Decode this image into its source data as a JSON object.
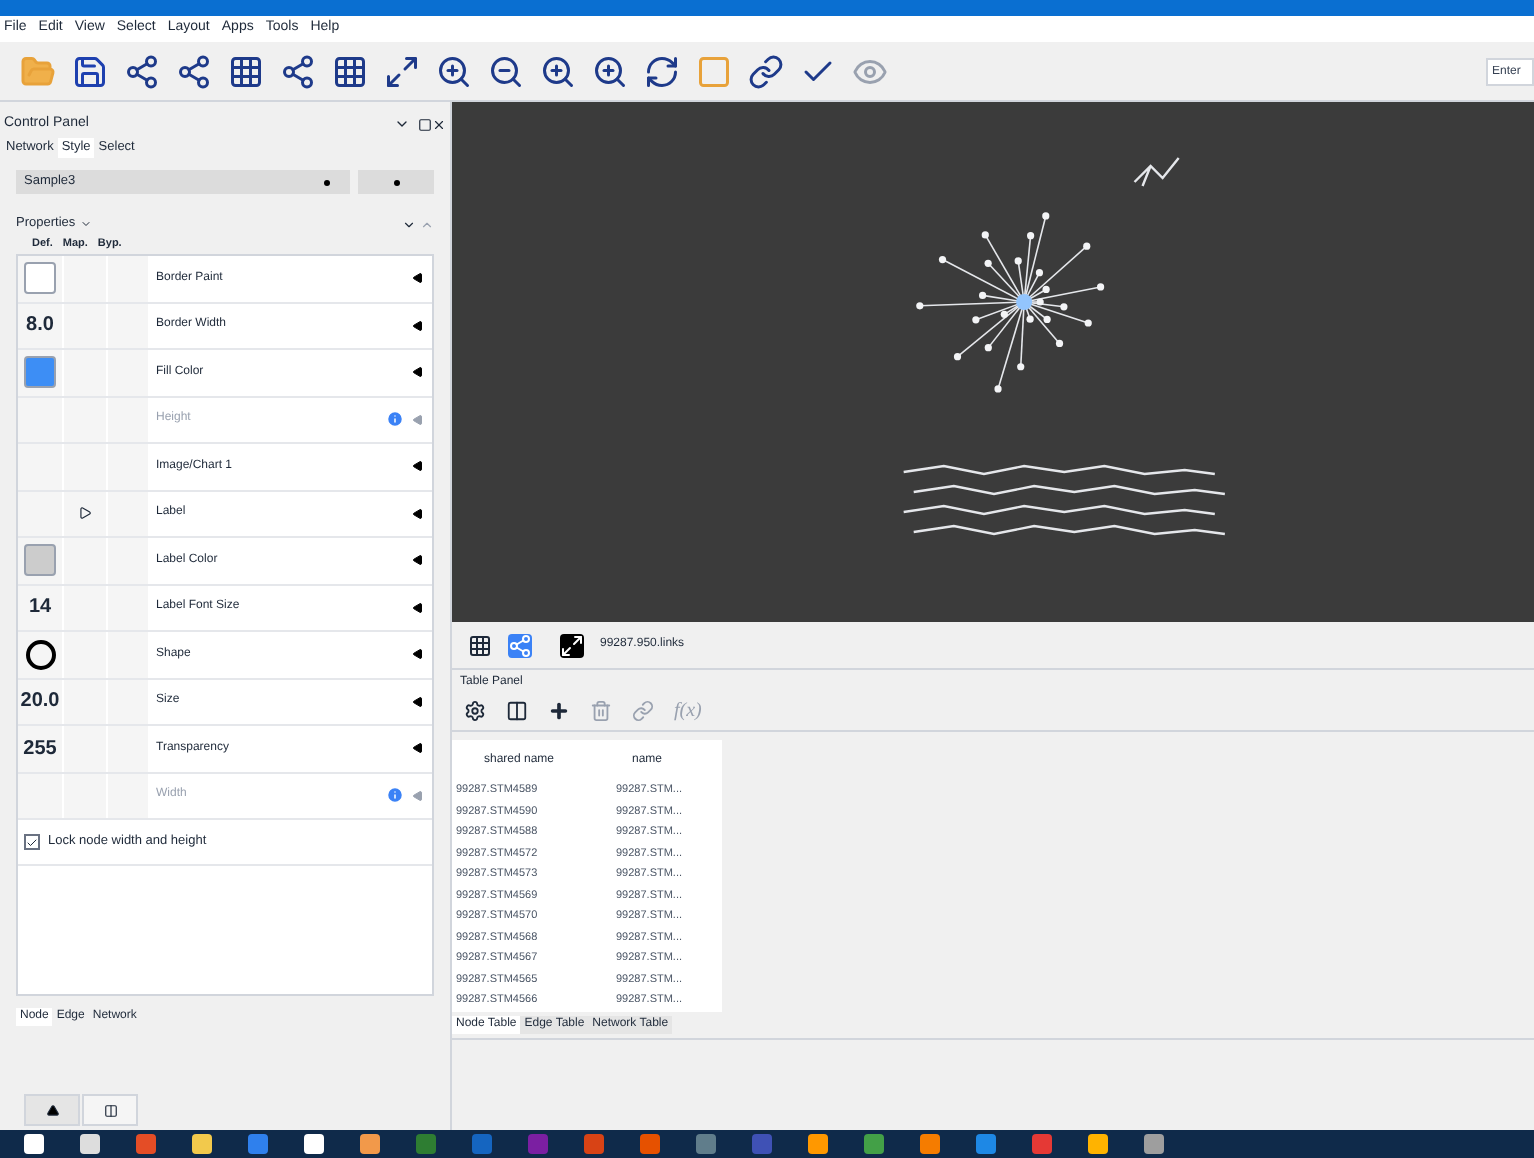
{
  "menu": [
    "File",
    "Edit",
    "View",
    "Select",
    "Layout",
    "Apps",
    "Tools",
    "Help"
  ],
  "search": {
    "placeholder": "Enter"
  },
  "control_panel": {
    "title": "Control Panel",
    "tabs": [
      {
        "label": "Network",
        "selected": false
      },
      {
        "label": "Style",
        "selected": true
      },
      {
        "label": "Select",
        "selected": false
      }
    ],
    "style": "Sample3",
    "properties_label": "Properties",
    "columns": [
      "Def.",
      "Map.",
      "Byp."
    ],
    "rows": [
      {
        "label": "Border Paint",
        "def": {
          "kind": "color",
          "color": "#ffffff"
        },
        "mapped": false,
        "disabled": false
      },
      {
        "label": "Border Width",
        "def": {
          "kind": "text",
          "value": "8.0"
        },
        "mapped": false,
        "disabled": false
      },
      {
        "label": "Fill Color",
        "def": {
          "kind": "color",
          "color": "#3d8ef5"
        },
        "mapped": false,
        "disabled": false
      },
      {
        "label": "Height",
        "def": {
          "kind": "none"
        },
        "mapped": false,
        "disabled": true
      },
      {
        "label": "Image/Chart 1",
        "def": {
          "kind": "none"
        },
        "mapped": false,
        "disabled": false
      },
      {
        "label": "Label",
        "def": {
          "kind": "none"
        },
        "mapped": true,
        "disabled": false
      },
      {
        "label": "Label Color",
        "def": {
          "kind": "color",
          "color": "#cccccc"
        },
        "mapped": false,
        "disabled": false
      },
      {
        "label": "Label Font Size",
        "def": {
          "kind": "text",
          "value": "14"
        },
        "mapped": false,
        "disabled": false
      },
      {
        "label": "Shape",
        "def": {
          "kind": "shape"
        },
        "mapped": false,
        "disabled": false
      },
      {
        "label": "Size",
        "def": {
          "kind": "text",
          "value": "20.0"
        },
        "mapped": false,
        "disabled": false
      },
      {
        "label": "Transparency",
        "def": {
          "kind": "text",
          "value": "255"
        },
        "mapped": false,
        "disabled": false
      },
      {
        "label": "Width",
        "def": {
          "kind": "none"
        },
        "mapped": false,
        "disabled": true
      }
    ],
    "lock": {
      "label": "Lock node width and height",
      "checked": true
    },
    "bottom_tabs": [
      {
        "label": "Node",
        "selected": true
      },
      {
        "label": "Edge",
        "selected": false
      },
      {
        "label": "Network",
        "selected": false
      }
    ]
  },
  "network_view": {
    "status": "99287.950.links"
  },
  "table_panel": {
    "title": "Table Panel",
    "function_button": "f(x)",
    "columns": [
      "shared name",
      "name"
    ],
    "rows": [
      [
        "99287.STM4589",
        "99287.STM..."
      ],
      [
        "99287.STM4590",
        "99287.STM..."
      ],
      [
        "99287.STM4588",
        "99287.STM..."
      ],
      [
        "99287.STM4572",
        "99287.STM..."
      ],
      [
        "99287.STM4573",
        "99287.STM..."
      ],
      [
        "99287.STM4569",
        "99287.STM..."
      ],
      [
        "99287.STM4570",
        "99287.STM..."
      ],
      [
        "99287.STM4568",
        "99287.STM..."
      ],
      [
        "99287.STM4567",
        "99287.STM..."
      ],
      [
        "99287.STM4565",
        "99287.STM..."
      ],
      [
        "99287.STM4566",
        "99287.STM..."
      ]
    ],
    "tabs": [
      {
        "label": "Node Table",
        "selected": true
      },
      {
        "label": "Edge Table",
        "selected": false
      },
      {
        "label": "Network Table",
        "selected": false
      }
    ]
  }
}
